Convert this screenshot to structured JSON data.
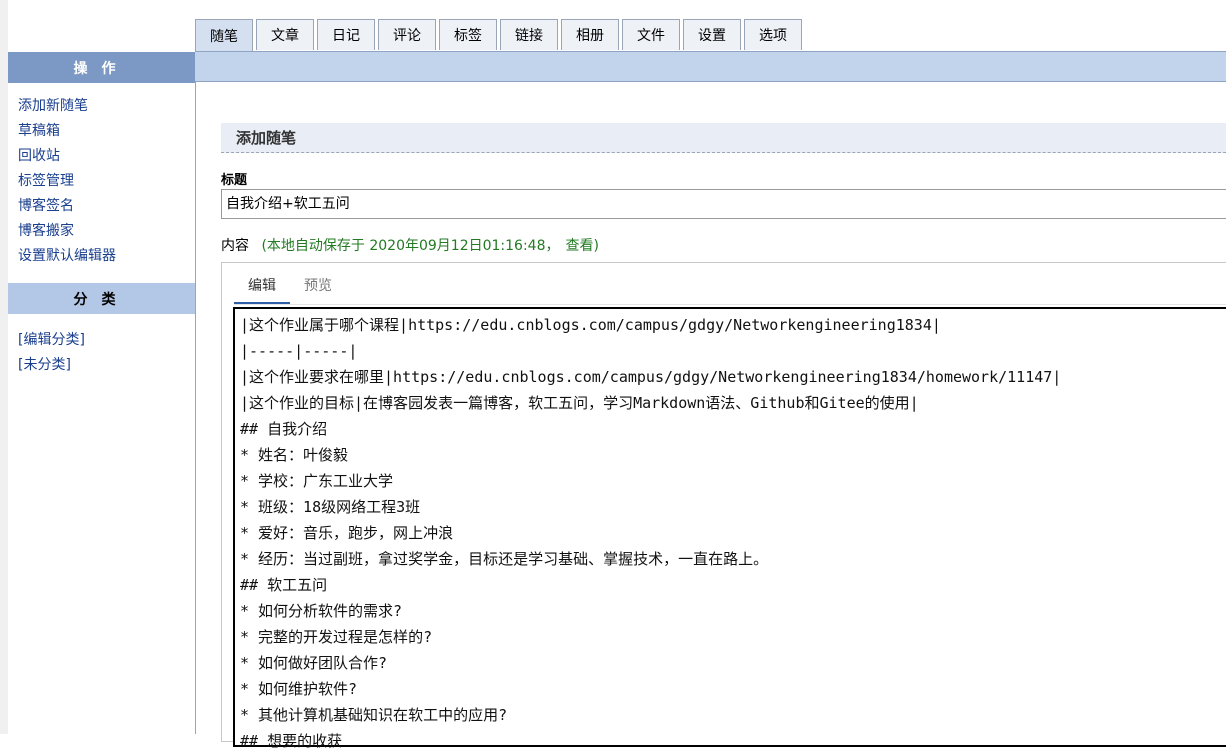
{
  "tabs": [
    "随笔",
    "文章",
    "日记",
    "评论",
    "标签",
    "链接",
    "相册",
    "文件",
    "设置",
    "选项"
  ],
  "sidebar": {
    "ops_title": "操作",
    "ops_links": [
      "添加新随笔",
      "草稿箱",
      "回收站",
      "标签管理",
      "博客签名",
      "博客搬家",
      "设置默认编辑器"
    ],
    "cat_title": "分类",
    "cat_links": [
      "[编辑分类]",
      "[未分类]"
    ]
  },
  "panel": {
    "heading": "添加随笔"
  },
  "form": {
    "title_label": "标题",
    "title_value": "自我介绍+软工五问",
    "content_label": "内容",
    "autosave_text": "(本地自动保存于 2020年09月12日01:16:48，",
    "view_link": "查看",
    "autosave_close": ")"
  },
  "editor": {
    "tab_edit": "编辑",
    "tab_preview": "预览",
    "lines": [
      "|这个作业属于哪个课程|https://edu.cnblogs.com/campus/gdgy/Networkengineering1834|",
      "|-----|-----|",
      "|这个作业要求在哪里|https://edu.cnblogs.com/campus/gdgy/Networkengineering1834/homework/11147|",
      "|这个作业的目标|在博客园发表一篇博客，软工五问，学习Markdown语法、Github和Gitee的使用|",
      "## 自我介绍",
      "* 姓名：叶俊毅",
      "* 学校：广东工业大学",
      "* 班级：18级网络工程3班",
      "* 爱好：音乐，跑步，网上冲浪",
      "* 经历：当过副班，拿过奖学金，目标还是学习基础、掌握技术，一直在路上。",
      "## 软工五问",
      "* 如何分析软件的需求?",
      "* 完整的开发过程是怎样的?",
      "* 如何做好团队合作?",
      "* 如何维护软件?",
      "* 其他计算机基础知识在软工中的应用?",
      "## 想要的收获"
    ]
  }
}
